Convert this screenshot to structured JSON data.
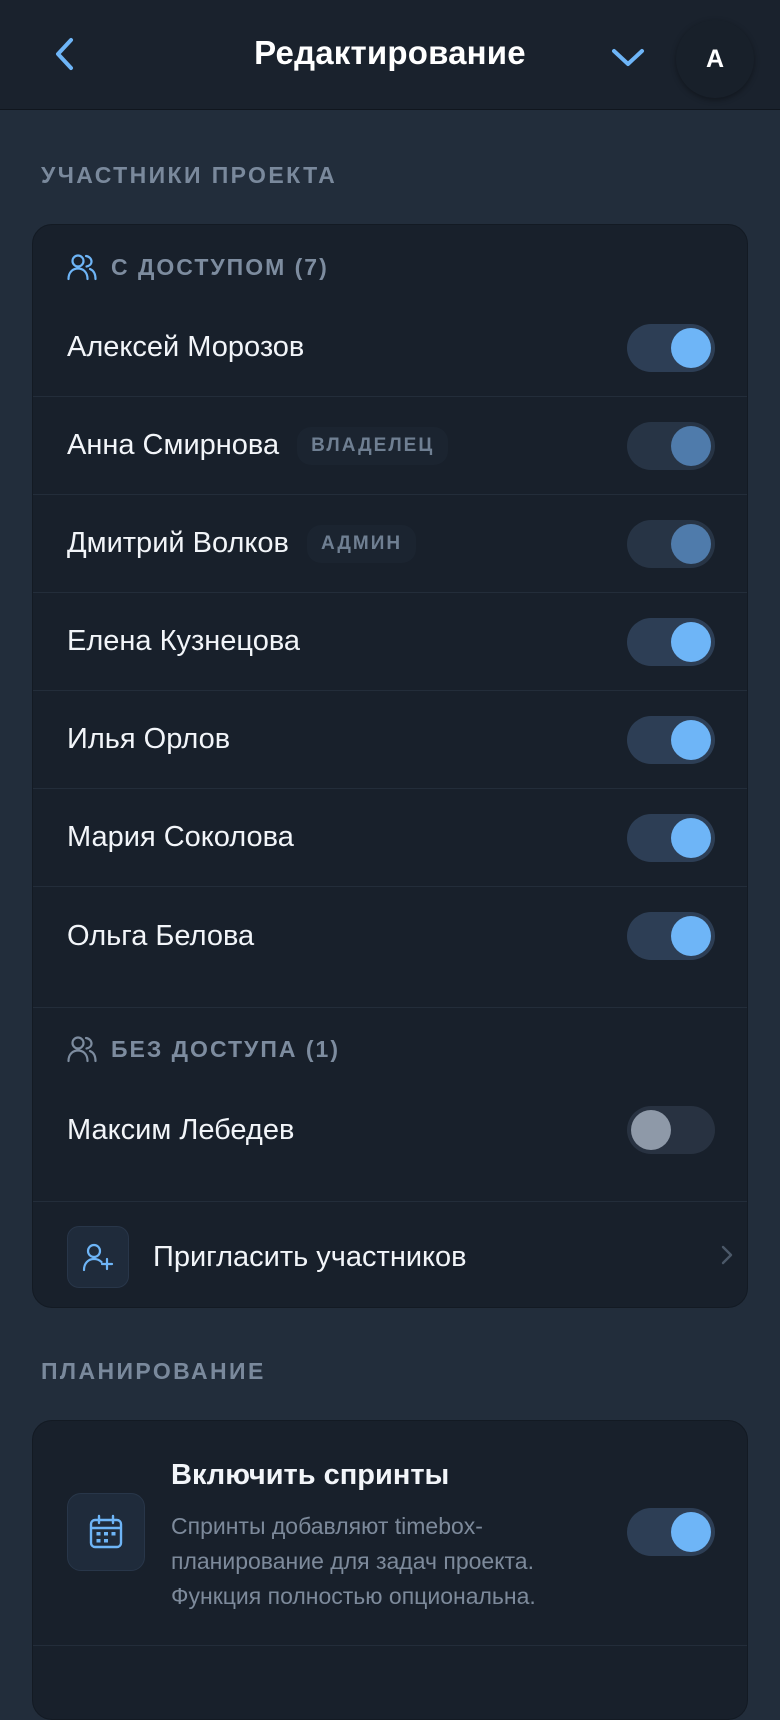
{
  "header": {
    "title": "Редактирование",
    "avatar_initial": "A"
  },
  "sections": {
    "members_label": "УЧАСТНИКИ ПРОЕКТА",
    "planning_label": "ПЛАНИРОВАНИЕ"
  },
  "members": {
    "with_access_title": "С ДОСТУПОМ (7)",
    "with_access": [
      {
        "name": "Алексей Морозов",
        "badge": "",
        "enabled": true,
        "locked": false
      },
      {
        "name": "Анна Смирнова",
        "badge": "ВЛАДЕЛЕЦ",
        "enabled": true,
        "locked": true
      },
      {
        "name": "Дмитрий Волков",
        "badge": "АДМИН",
        "enabled": true,
        "locked": true
      },
      {
        "name": "Елена Кузнецова",
        "badge": "",
        "enabled": true,
        "locked": false
      },
      {
        "name": "Илья Орлов",
        "badge": "",
        "enabled": true,
        "locked": false
      },
      {
        "name": "Мария Соколова",
        "badge": "",
        "enabled": true,
        "locked": false
      },
      {
        "name": "Ольга Белова",
        "badge": "",
        "enabled": true,
        "locked": false
      }
    ],
    "without_access_title": "БЕЗ ДОСТУПА (1)",
    "without_access": [
      {
        "name": "Максим Лебедев",
        "enabled": false
      }
    ],
    "invite_label": "Пригласить участников"
  },
  "planning": {
    "sprints_title": "Включить спринты",
    "sprints_desc": "Спринты добавляют timebox-планирование для задач проекта. Функция полностью опциональна.",
    "sprints_enabled": true
  },
  "colors": {
    "accent": "#6eb5f7",
    "background": "#222d3b",
    "card": "#18202b"
  }
}
